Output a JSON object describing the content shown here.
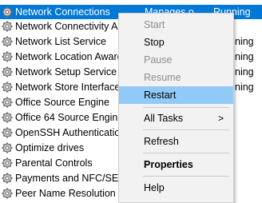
{
  "services": [
    {
      "name": "Network Connections",
      "description": "Manages o",
      "status": "Running",
      "selected": true
    },
    {
      "name": "Network Connectivity A",
      "description": "",
      "status": ""
    },
    {
      "name": "Network List Service",
      "description": "",
      "status": "ning"
    },
    {
      "name": "Network Location Aware",
      "description": "",
      "status": "ning"
    },
    {
      "name": "Network Setup Service",
      "description": "",
      "status": "ning"
    },
    {
      "name": "Network Store Interface",
      "description": "",
      "status": "ning"
    },
    {
      "name": "Office  Source Engine",
      "description": "",
      "status": ""
    },
    {
      "name": "Office 64 Source Engine",
      "description": "",
      "status": ""
    },
    {
      "name": "OpenSSH Authentication",
      "description": "",
      "status": ""
    },
    {
      "name": "Optimize drives",
      "description": "",
      "status": ""
    },
    {
      "name": "Parental Controls",
      "description": "",
      "status": ""
    },
    {
      "name": "Payments and NFC/SE M",
      "description": "",
      "status": ""
    },
    {
      "name": "Peer Name Resolution P",
      "description": "",
      "status": ""
    }
  ],
  "context_menu": {
    "start": "Start",
    "stop": "Stop",
    "pause": "Pause",
    "resume": "Resume",
    "restart": "Restart",
    "all_tasks": "All Tasks",
    "all_tasks_arrow": ">",
    "refresh": "Refresh",
    "properties": "Properties",
    "help": "Help"
  },
  "colors": {
    "selection": "#0078d7",
    "menu_background": "#f2f2f2",
    "menu_highlight": "#91c9f7",
    "disabled_text": "#8d8d8d"
  },
  "icons": {
    "service": "gear-icon"
  }
}
